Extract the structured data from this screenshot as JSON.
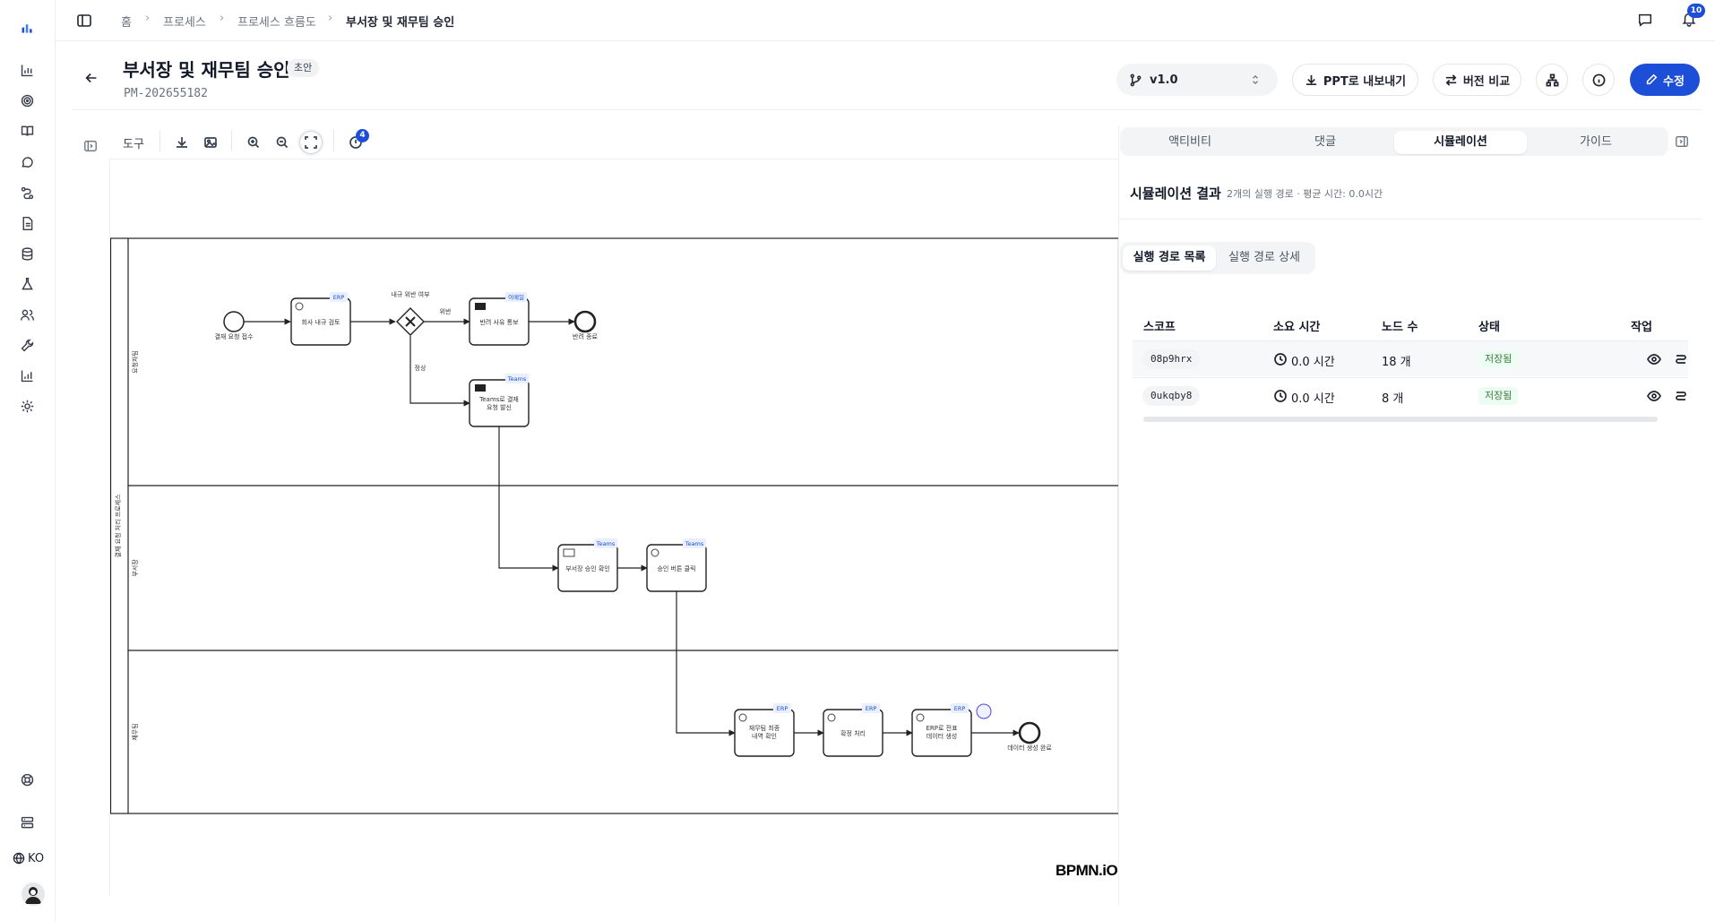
{
  "app": {
    "logo": "logo-icon"
  },
  "rail": {
    "items": [
      "dashboard-icon",
      "target-icon",
      "book-icon",
      "chat-icon",
      "flow-icon",
      "document-icon",
      "database-icon",
      "flask-icon",
      "users-icon",
      "wrench-icon",
      "chart-icon",
      "settings-icon"
    ],
    "bottom": {
      "help": "help-icon",
      "servers": "server-icon",
      "lang": "KO"
    }
  },
  "breadcrumb": {
    "items": [
      "홈",
      "프로세스",
      "프로세스 흐름도",
      "부서장 및 재무팀 승인"
    ]
  },
  "topbar": {
    "notification_count": "10"
  },
  "header": {
    "title": "부서장 및 재무팀 승인",
    "status": "초안",
    "code": "PM-202655182",
    "version": "v1.0",
    "export_ppt": "PPT로 내보내기",
    "compare": "버전 비교",
    "edit": "수정"
  },
  "toolbar": {
    "label": "도구",
    "badge": "4"
  },
  "diagram": {
    "pool_label": "결재 요청 처리 프로세스",
    "lanes": [
      "요청자팀",
      "부서장",
      "재무팀"
    ],
    "nodes": {
      "start": "결재 요청 접수",
      "t1": "회사 내규 검토",
      "gw": "내규 위반 여부",
      "violation": "위반",
      "normal": "정상",
      "t2": "반려 사유 통보",
      "end1": "반려 종료",
      "t3": "Teams로 결재 요청 발신",
      "t4": "부서장 승인 확인",
      "t5": "승인 버튼 클릭",
      "t6": "재무팀 최종 내역 확인",
      "t7": "확정 처리",
      "t8": "ERP로 전표 데이터 생성",
      "end2": "데이터 생성 완료"
    },
    "tags": {
      "erp": "ERP",
      "mail": "이메일",
      "teams": "Teams"
    },
    "watermark": "BPMN.iO"
  },
  "panel": {
    "tabs": [
      "액티비티",
      "댓글",
      "시뮬레이션",
      "가이드"
    ],
    "active_tab": "시뮬레이션",
    "sim_title": "시뮬레이션 결과",
    "sim_subtitle": "2개의 실행 경로 · 평균 시간: 0.0시간",
    "segments": [
      "실행 경로 목록",
      "실행 경로 상세"
    ],
    "table": {
      "headers": [
        "스코프",
        "소요 시간",
        "노드 수",
        "상태",
        "작업"
      ],
      "rows": [
        {
          "scope": "08p9hrx",
          "duration": "0.0 시간",
          "nodes": "18 개",
          "status": "저장됨"
        },
        {
          "scope": "0ukqby8",
          "duration": "0.0 시간",
          "nodes": "8 개",
          "status": "저장됨"
        }
      ]
    }
  }
}
